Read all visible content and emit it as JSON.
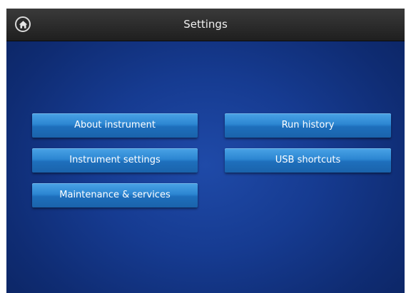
{
  "header": {
    "title": "Settings",
    "home_icon": "home-icon"
  },
  "buttons": {
    "about_instrument": "About instrument",
    "run_history": "Run history",
    "instrument_settings": "Instrument settings",
    "usb_shortcuts": "USB shortcuts",
    "maintenance_services": "Maintenance & services"
  },
  "colors": {
    "background": "#163b91",
    "button": "#2c86d2",
    "titlebar": "#2a2a2a"
  }
}
